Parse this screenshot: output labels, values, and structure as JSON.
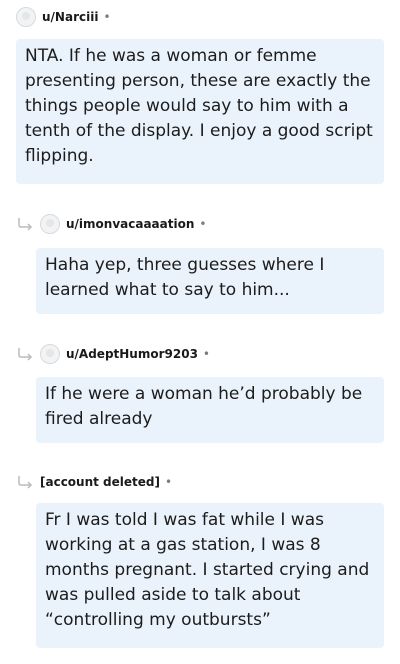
{
  "comments": [
    {
      "username": "u/Narciii",
      "separator": "•",
      "text": "NTA. If he was a woman or femme presenting person, these are exactly the things people would say to him with a tenth of the display. I enjoy a good script flipping."
    },
    {
      "username": "u/imonvacaaaation",
      "separator": "•",
      "text": "Haha yep, three guesses where I learned what to say to him..."
    },
    {
      "username": "u/AdeptHumor9203",
      "separator": "•",
      "text": "If he were a woman he’d probably be fired already"
    },
    {
      "username": "[account deleted]",
      "separator": "•",
      "text": "Fr I was told I was fat while I was working at a gas station, I was 8 months pregnant. I started crying and was pulled aside to talk about “controlling my outbursts”"
    }
  ],
  "colors": {
    "bubble_bg": "#eaf2fb",
    "text": "#1c1c1c",
    "meta": "#7c7c7c"
  },
  "icons": {
    "avatar": "default-avatar-icon",
    "reply": "reply-arrow-icon"
  }
}
